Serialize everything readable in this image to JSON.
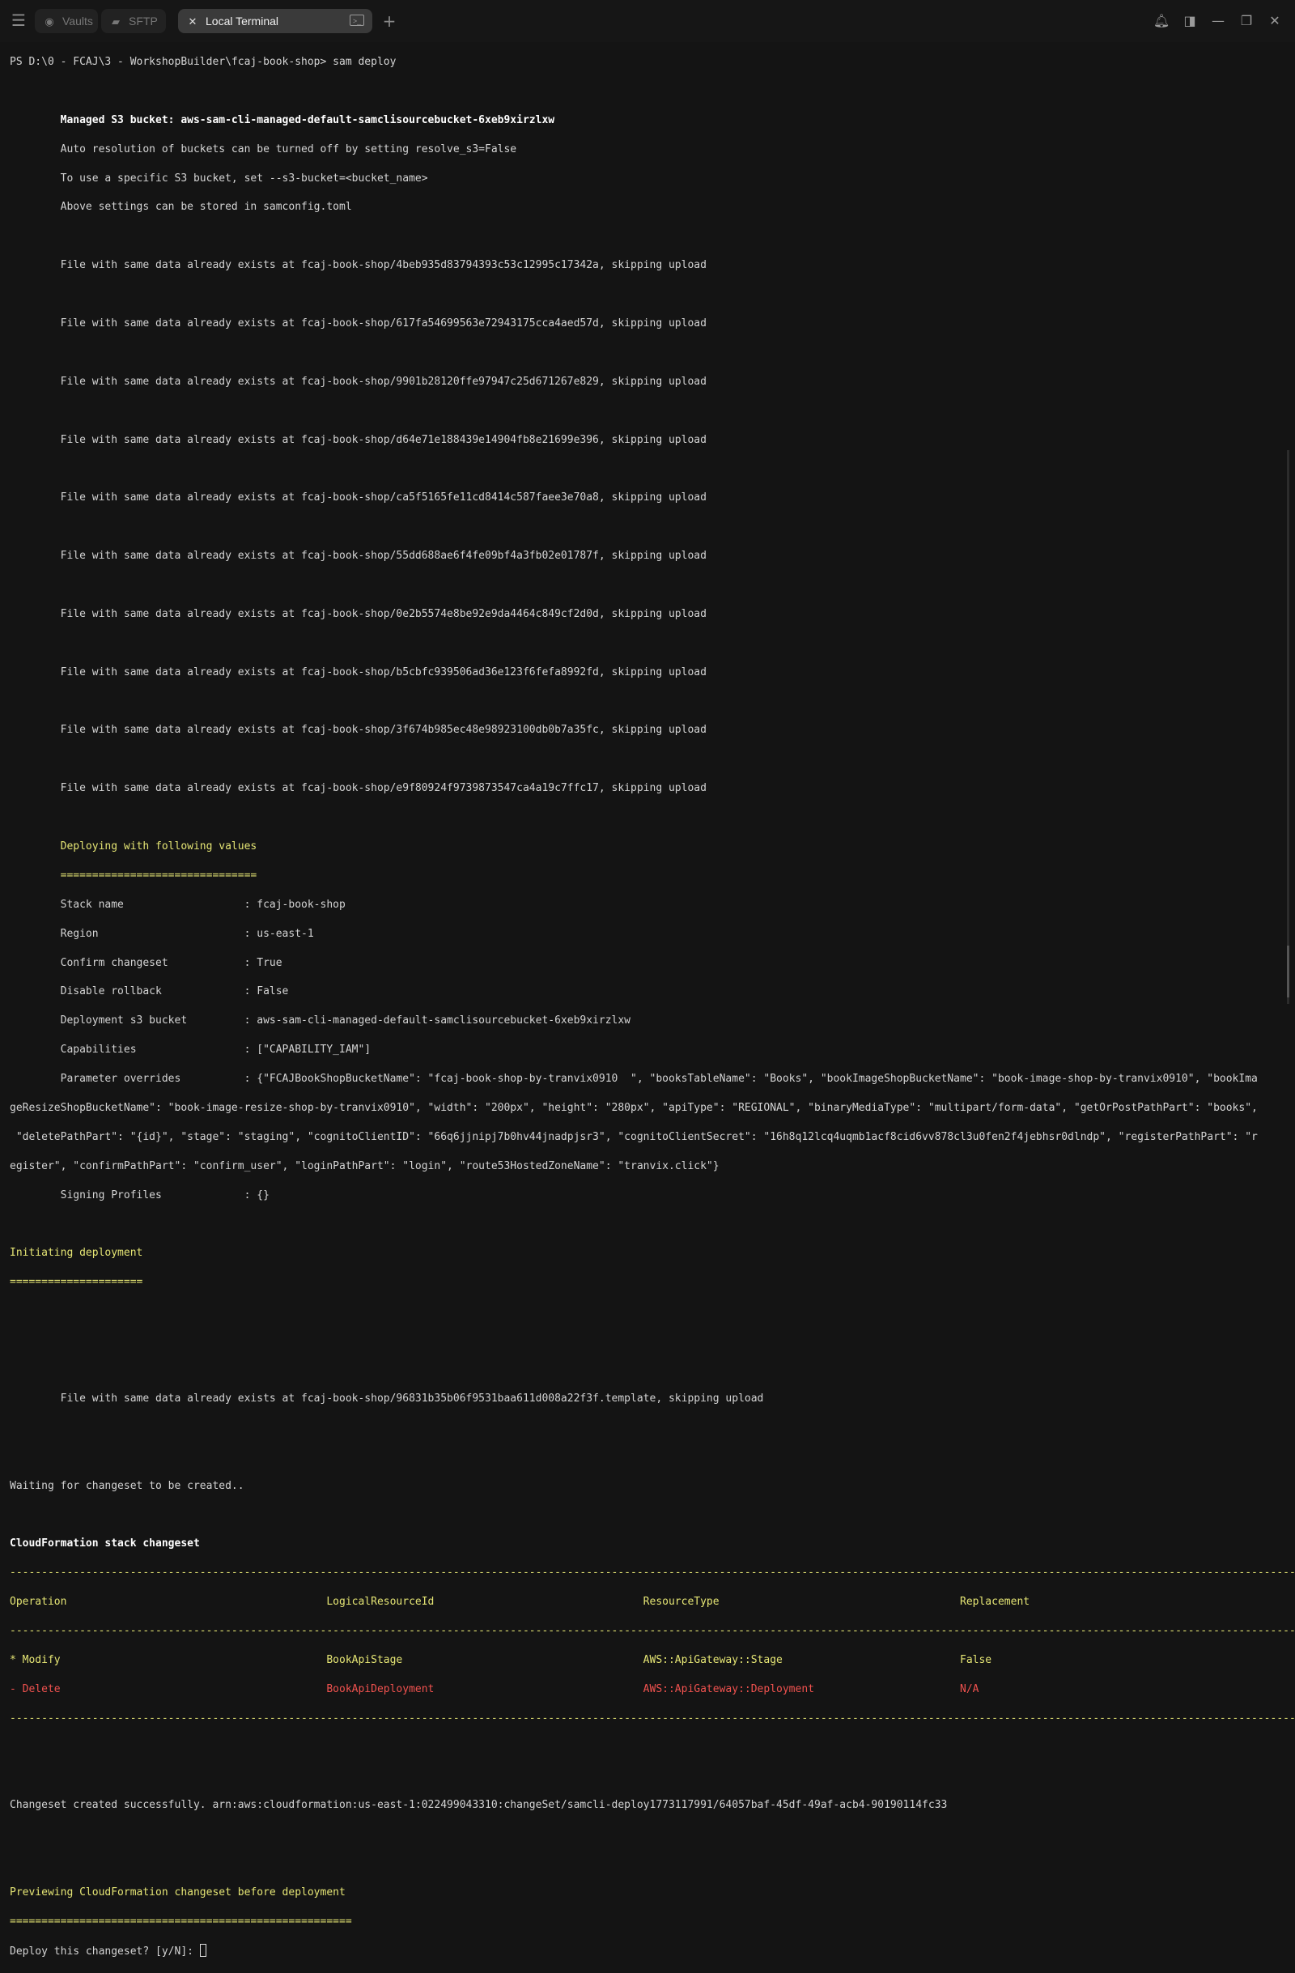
{
  "tabs": [
    {
      "label": "Vaults",
      "icon": "vault-icon"
    },
    {
      "label": "SFTP",
      "icon": "folder-icon"
    },
    {
      "label": "Local Terminal",
      "icon": "close-icon",
      "active": true
    }
  ],
  "terminal": {
    "prompt": "PS D:\\0 - FCAJ\\3 - WorkshopBuilder\\fcaj-book-shop> ",
    "command": "sam deploy",
    "managed_bucket": "        Managed S3 bucket: aws-sam-cli-managed-default-samclisourcebucket-6xeb9xirzlxw",
    "info": [
      "        Auto resolution of buckets can be turned off by setting resolve_s3=False",
      "        To use a specific S3 bucket, set --s3-bucket=<bucket_name>",
      "        Above settings can be stored in samconfig.toml"
    ],
    "uploads": [
      "        File with same data already exists at fcaj-book-shop/4beb935d83794393c53c12995c17342a, skipping upload",
      "        File with same data already exists at fcaj-book-shop/617fa54699563e72943175cca4aed57d, skipping upload",
      "        File with same data already exists at fcaj-book-shop/9901b28120ffe97947c25d671267e829, skipping upload",
      "        File with same data already exists at fcaj-book-shop/d64e71e188439e14904fb8e21699e396, skipping upload",
      "        File with same data already exists at fcaj-book-shop/ca5f5165fe11cd8414c587faee3e70a8, skipping upload",
      "        File with same data already exists at fcaj-book-shop/55dd688ae6f4fe09bf4a3fb02e01787f, skipping upload",
      "        File with same data already exists at fcaj-book-shop/0e2b5574e8be92e9da4464c849cf2d0d, skipping upload",
      "        File with same data already exists at fcaj-book-shop/b5cbfc939506ad36e123f6fefa8992fd, skipping upload",
      "        File with same data already exists at fcaj-book-shop/3f674b985ec48e98923100db0b7a35fc, skipping upload",
      "        File with same data already exists at fcaj-book-shop/e9f80924f9739873547ca4a19c7ffc17, skipping upload"
    ],
    "deploying_title": "        Deploying with following values",
    "deploying_rule": "        ===============================",
    "values": [
      "        Stack name                   : fcaj-book-shop",
      "        Region                       : us-east-1",
      "        Confirm changeset            : True",
      "        Disable rollback             : False",
      "        Deployment s3 bucket         : aws-sam-cli-managed-default-samclisourcebucket-6xeb9xirzlxw",
      "        Capabilities                 : [\"CAPABILITY_IAM\"]",
      "        Parameter overrides          : {\"FCAJBookShopBucketName\": \"fcaj-book-shop-by-tranvix0910  \", \"booksTableName\": \"Books\", \"bookImageShopBucketName\": \"book-image-shop-by-tranvix0910\", \"bookIma",
      "geResizeShopBucketName\": \"book-image-resize-shop-by-tranvix0910\", \"width\": \"200px\", \"height\": \"280px\", \"apiType\": \"REGIONAL\", \"binaryMediaType\": \"multipart/form-data\", \"getOrPostPathPart\": \"books\",",
      " \"deletePathPart\": \"{id}\", \"stage\": \"staging\", \"cognitoClientID\": \"66q6jjnipj7b0hv44jnadpjsr3\", \"cognitoClientSecret\": \"16h8q12lcq4uqmb1acf8cid6vv878cl3u0fen2f4jebhsr0dlndp\", \"registerPathPart\": \"r",
      "egister\", \"confirmPathPart\": \"confirm_user\", \"loginPathPart\": \"login\", \"route53HostedZoneName\": \"tranvix.click\"}",
      "        Signing Profiles             : {}"
    ],
    "initiating_title": "Initiating deployment",
    "initiating_rule": "=====================",
    "template_upload": "        File with same data already exists at fcaj-book-shop/96831b35b06f9531baa611d008a22f3f.template, skipping upload",
    "waiting": "Waiting for changeset to be created..",
    "changeset_title": "CloudFormation stack changeset",
    "dash_rule": "-------------------------------------------------------------------------------------------------------------------------------------------------------------------------------------------------------------------",
    "header_row": "Operation                                         LogicalResourceId                                 ResourceType                                      Replacement",
    "modify_row": "* Modify                                          BookApiStage                                      AWS::ApiGateway::Stage                            False",
    "delete_row": "- Delete                                          BookApiDeployment                                 AWS::ApiGateway::Deployment                       N/A",
    "changeset_created": "Changeset created successfully. arn:aws:cloudformation:us-east-1:022499043310:changeSet/samcli-deploy1773117991/64057baf-45df-49af-acb4-90190114fc33",
    "previewing_title": "Previewing CloudFormation changeset before deployment",
    "previewing_rule": "======================================================",
    "deploy_prompt": "Deploy this changeset? [y/N]: "
  },
  "colors": {
    "background": "#141414",
    "text": "#d4d4d4",
    "yellow": "#e5e574",
    "red": "#f0524f"
  }
}
